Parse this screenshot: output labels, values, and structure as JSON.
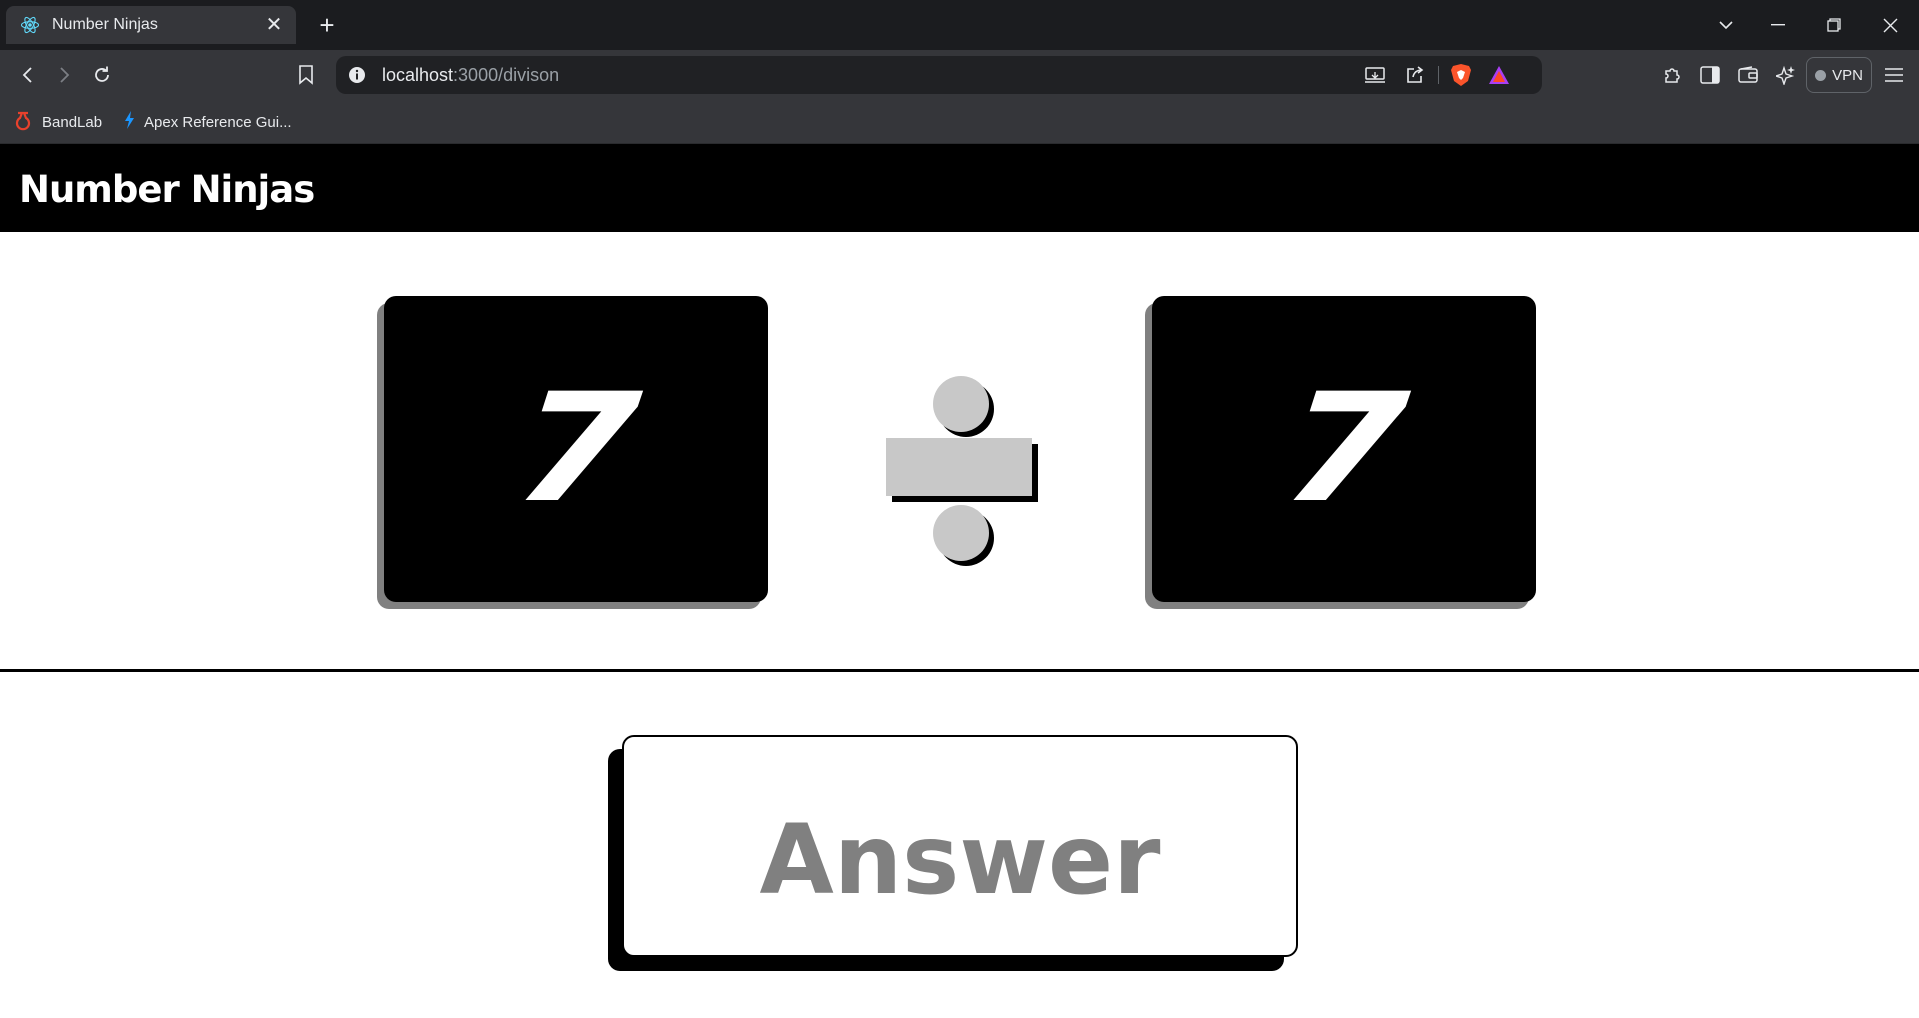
{
  "browser": {
    "tab": {
      "title": "Number Ninjas",
      "favicon": "react-icon"
    },
    "address": {
      "host": "localhost",
      "path": ":3000/divison"
    },
    "bookmarks": [
      {
        "label": "BandLab",
        "icon": "bandlab-icon",
        "color": "#e8412c"
      },
      {
        "label": "Apex Reference Gui...",
        "icon": "lightning-icon",
        "color": "#1b96ff"
      }
    ],
    "vpn_label": "VPN"
  },
  "app": {
    "title": "Number Ninjas",
    "problem": {
      "left_operand": "7",
      "operator": "divide",
      "right_operand": "7"
    },
    "answer": {
      "placeholder": "Answer",
      "value": ""
    }
  },
  "colors": {
    "card_bg": "#000000",
    "card_shadow": "#808080",
    "operator_fill": "#c8c8c8",
    "answer_text": "#808080"
  }
}
